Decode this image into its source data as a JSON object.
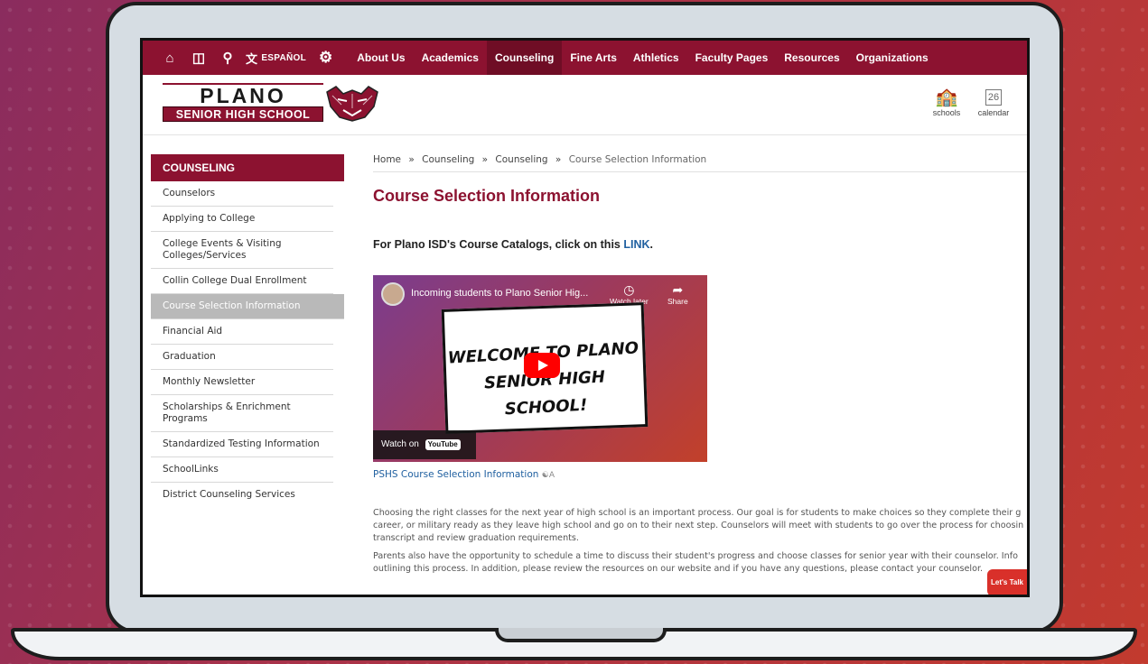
{
  "topnav": {
    "icons": [
      "home-icon",
      "monitor-icon",
      "search-icon",
      "translate-icon",
      "gear-icon"
    ],
    "espanol_label": "ESPAÑOL",
    "items": [
      {
        "label": "About Us",
        "active": false
      },
      {
        "label": "Academics",
        "active": false
      },
      {
        "label": "Counseling",
        "active": true
      },
      {
        "label": "Fine Arts",
        "active": false
      },
      {
        "label": "Athletics",
        "active": false
      },
      {
        "label": "Faculty Pages",
        "active": false
      },
      {
        "label": "Resources",
        "active": false
      },
      {
        "label": "Organizations",
        "active": false
      }
    ]
  },
  "header": {
    "logo_top": "PLANO",
    "logo_bottom": "SENIOR HIGH SCHOOL",
    "schools_label": "schools",
    "calendar_label": "calendar",
    "calendar_day": "26"
  },
  "sidebar": {
    "title": "COUNSELING",
    "items": [
      {
        "label": "Counselors",
        "active": false
      },
      {
        "label": "Applying to College",
        "active": false
      },
      {
        "label": "College Events & Visiting Colleges/Services",
        "active": false
      },
      {
        "label": "Collin College Dual Enrollment",
        "active": false
      },
      {
        "label": "Course Selection Information",
        "active": true
      },
      {
        "label": "Financial Aid",
        "active": false
      },
      {
        "label": "Graduation",
        "active": false
      },
      {
        "label": "Monthly Newsletter",
        "active": false
      },
      {
        "label": "Scholarships & Enrichment Programs",
        "active": false
      },
      {
        "label": "Standardized Testing Information",
        "active": false
      },
      {
        "label": "SchoolLinks",
        "active": false
      },
      {
        "label": "District Counseling Services",
        "active": false
      }
    ]
  },
  "breadcrumb": {
    "items": [
      "Home",
      "Counseling",
      "Counseling",
      "Course Selection Information"
    ],
    "separator": "»"
  },
  "main": {
    "title": "Course Selection Information",
    "catalog_text": "For Plano ISD's Course Catalogs, click on this ",
    "catalog_link": "LINK",
    "catalog_end": ".",
    "video": {
      "title": "Incoming students to Plano Senior Hig...",
      "watch_later": "Watch later",
      "share": "Share",
      "bubble_line1": "WELCOME TO PLANO",
      "bubble_line2": "SENIOR HIGH SCHOOL!",
      "watch_on": "Watch on",
      "youtube": "YouTube"
    },
    "video_caption": "PSHS Course Selection Information",
    "para1": [
      "Choosing the right classes for the next year of high school is an important process. Our goal is for students to make choices so they complete their g",
      "career, or military ready as they leave high school and go on to their next step. Counselors will meet with students to go over the process for choosin",
      "transcript and review graduation requirements."
    ],
    "para2": [
      "Parents also have the opportunity to schedule a time to discuss their student's progress and choose classes for senior year with their counselor. Info",
      "outlining this process. In addition, please review the resources on our website and if you have any questions, please contact your counselor."
    ],
    "chat_label": "Let's Talk"
  }
}
